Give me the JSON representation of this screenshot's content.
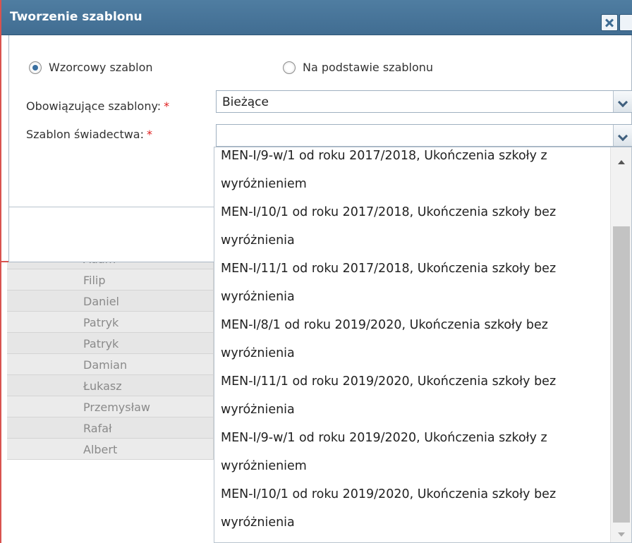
{
  "dialog": {
    "title": "Tworzenie szablonu",
    "close_icon": "close-icon",
    "help_icon": "help-icon"
  },
  "form": {
    "radio_options": [
      {
        "label": "Wzorcowy szablon",
        "checked": true
      },
      {
        "label": "Na podstawie szablonu",
        "checked": false
      }
    ],
    "fields": [
      {
        "label": "Obowiązujące szablony:",
        "required": "*",
        "value": "Bieżące"
      },
      {
        "label": "Szablon świadectwa:",
        "required": "*",
        "value": ""
      }
    ]
  },
  "dropdown": {
    "options": [
      "MEN-I/9-w/1 od roku 2017/2018, Ukończenia szkoły z",
      "wyróżnieniem",
      "MEN-I/10/1 od roku 2017/2018, Ukończenia szkoły bez",
      "wyróżnienia",
      "MEN-I/11/1 od roku 2017/2018, Ukończenia szkoły bez",
      "wyróżnienia",
      "MEN-I/8/1 od roku 2019/2020, Ukończenia szkoły bez",
      "wyróżnienia",
      "MEN-I/11/1 od roku 2019/2020, Ukończenia szkoły bez",
      "wyróżnienia",
      "MEN-I/9-w/1 od roku 2019/2020, Ukończenia szkoły z",
      "wyróżnieniem",
      "MEN-I/10/1 od roku 2019/2020, Ukończenia szkoły bez",
      "wyróżnienia"
    ]
  },
  "background_table": {
    "names": [
      "Adam",
      "Filip",
      "Daniel",
      "Patryk",
      "Patryk",
      "Damian",
      "Łukasz",
      "Przemysław",
      "Rafał",
      "Albert"
    ]
  }
}
